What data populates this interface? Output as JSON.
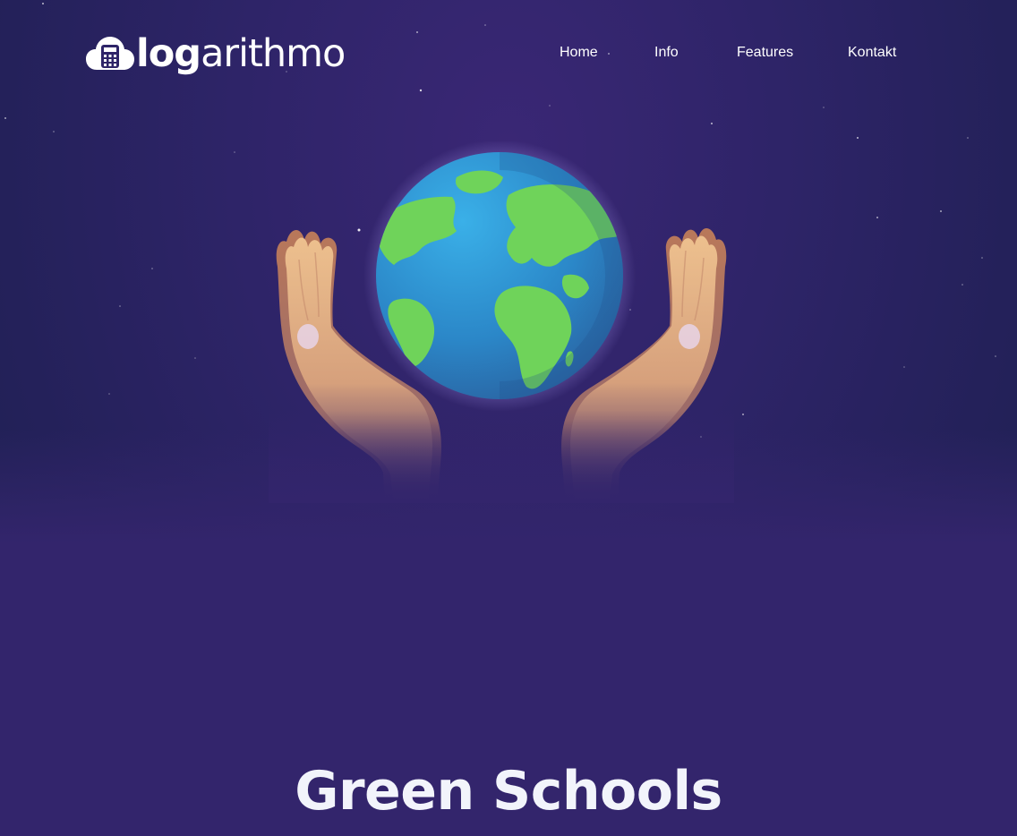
{
  "brand": {
    "logo_bold": "log",
    "logo_light": "arithmo",
    "logo_icon": "calculator-cloud-icon"
  },
  "nav": {
    "items": [
      {
        "label": "Home"
      },
      {
        "label": "Info"
      },
      {
        "label": "Features"
      },
      {
        "label": "Kontakt"
      }
    ]
  },
  "hero": {
    "illustration": "hands-holding-globe",
    "title": "Green Schools"
  },
  "colors": {
    "background": "#2e2468",
    "accent_green": "#6fd35a",
    "ocean_blue": "#2f8fd0",
    "skin": "#e8b98a",
    "text": "#ffffff"
  }
}
